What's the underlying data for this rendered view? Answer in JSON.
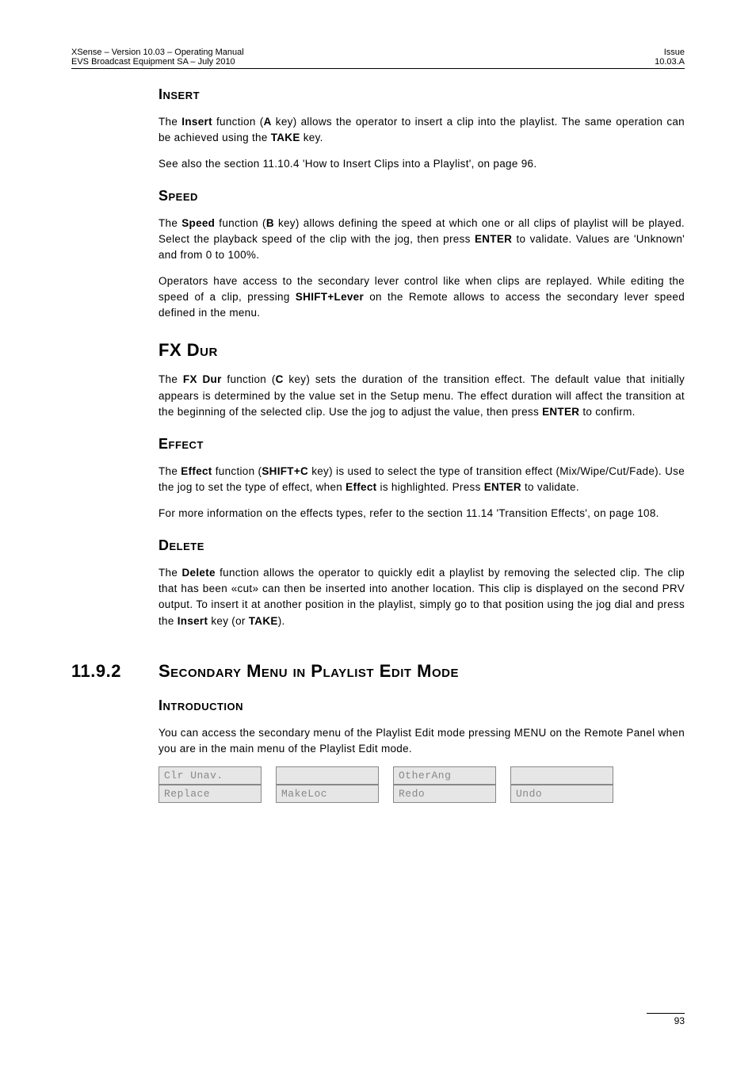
{
  "header": {
    "left1": "XSense – Version 10.03 – Operating Manual",
    "left2": "EVS Broadcast Equipment SA – July 2010",
    "right1": "Issue",
    "right2": "10.03.A"
  },
  "sections": {
    "insert": {
      "title": "Insert",
      "p": [
        "The <b>Insert</b> function (<b>A</b> key) allows the operator to insert a clip into the playlist. The same operation can be achieved using the <b>TAKE</b> key.",
        "See also the section 11.10.4 'How to Insert Clips into a Playlist', on page 96."
      ]
    },
    "speed": {
      "title": "Speed",
      "p": [
        "The <b>Speed</b> function (<b>B</b> key) allows defining the speed at which one or all clips of playlist will be played. Select the playback speed of the clip with the jog, then press <b>ENTER</b> to validate. Values are 'Unknown' and from 0 to 100%.",
        "Operators have access to the secondary lever control like when clips are replayed. While editing the speed of a clip, pressing <b>SHIFT+Lever</b> on the Remote allows to access the secondary lever speed defined in the menu."
      ]
    },
    "fxdur": {
      "title": "FX Dur",
      "p": [
        "The <b>FX Dur</b> function (<b>C</b> key) sets the duration of the transition effect. The default value that initially appears is determined by the value set in the Setup menu. The effect duration will affect the transition at the beginning of the selected clip. Use the jog to adjust the value, then press <b>ENTER</b> to confirm."
      ]
    },
    "effect": {
      "title": "Effect",
      "p": [
        "The <b>Effect</b> function (<b>SHIFT+C</b> key) is used to select the type of transition effect (Mix/Wipe/Cut/Fade). Use the jog to set the type of effect, when <b>Effect</b> is highlighted. Press <b>ENTER</b> to validate.",
        "For more information on the effects types, refer to the section 11.14 'Transition Effects', on page 108."
      ]
    },
    "delete": {
      "title": "Delete",
      "p": [
        "The <b>Delete</b> function allows the operator to quickly edit a playlist by removing the selected clip. The clip that has been «cut» can then be inserted into another location. This clip is displayed on the second PRV output. To insert it at another position in the playlist, simply go to that position using the jog dial and press the <b>Insert</b> key (or <b>TAKE</b>)."
      ]
    },
    "secondary": {
      "num": "11.9.2",
      "title": "Secondary Menu in Playlist Edit Mode",
      "intro_title": "Introduction",
      "p": [
        "You can access the secondary menu of the Playlist Edit mode pressing MENU on the Remote Panel when you are in the main menu of the Playlist Edit mode."
      ]
    }
  },
  "menu": {
    "r0c0": "Clr Unav.",
    "r0c1": "",
    "r0c2": "OtherAng",
    "r0c3": "",
    "r1c0": "Replace",
    "r1c1": "MakeLoc",
    "r1c2": "Redo",
    "r1c3": "Undo"
  },
  "footer": {
    "page": "93"
  }
}
